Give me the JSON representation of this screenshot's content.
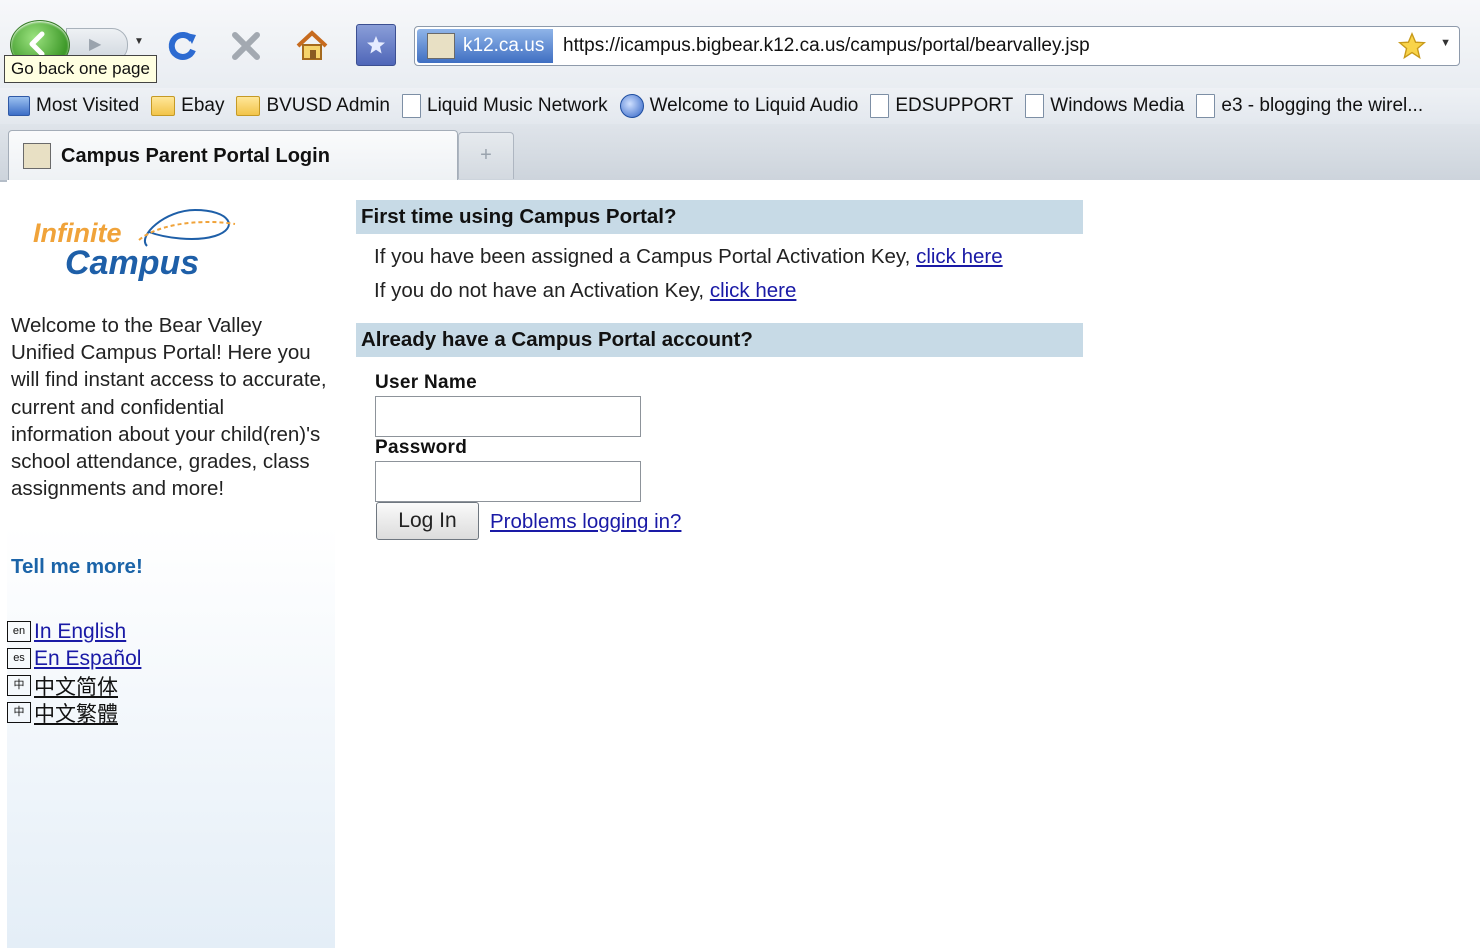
{
  "browser": {
    "tooltip": "Go back one page",
    "identity_label": "k12.ca.us",
    "url": "https://icampus.bigbear.k12.ca.us/campus/portal/bearvalley.jsp",
    "bookmarks": [
      {
        "label": "Most Visited",
        "icon": "most-visited-icon"
      },
      {
        "label": "Ebay",
        "icon": "folder-icon"
      },
      {
        "label": "BVUSD Admin",
        "icon": "folder-icon"
      },
      {
        "label": "Liquid Music Network",
        "icon": "page-icon"
      },
      {
        "label": "Welcome to Liquid Audio",
        "icon": "globe-icon"
      },
      {
        "label": "EDSUPPORT",
        "icon": "page-icon"
      },
      {
        "label": "Windows Media",
        "icon": "page-icon"
      },
      {
        "label": "e3 - blogging the wirel...",
        "icon": "page-icon"
      }
    ],
    "tab_title": "Campus Parent Portal Login",
    "new_tab_symbol": "+"
  },
  "logo": {
    "line1": "Infinite",
    "line2": "Campus"
  },
  "sidebar": {
    "welcome": "Welcome to the Bear Valley Unified Campus Portal! Here you will find instant access to accurate, current and confidential information about your child(ren)'s school attendance, grades, class assignments and more!",
    "tell_more": "Tell me more!",
    "languages": [
      {
        "flag": "en",
        "label": "In English"
      },
      {
        "flag": "es",
        "label": "En Español"
      },
      {
        "flag": "中",
        "label": "中文简体"
      },
      {
        "flag": "中",
        "label": "中文繁體"
      }
    ]
  },
  "main": {
    "first_time_header": "First time using Campus Portal?",
    "activation_have_text": "If you have been assigned a Campus Portal Activation Key, ",
    "activation_have_link": "click here",
    "activation_not_text": "If you do not have an Activation Key, ",
    "activation_not_link": "click here",
    "account_header": "Already have a Campus Portal account?",
    "username_label": "User Name",
    "username_value": "",
    "password_label": "Password",
    "password_value": "",
    "login_button": "Log In",
    "problems_link": "Problems logging in?"
  },
  "colors": {
    "section_header_bg": "#c7dae6",
    "link": "#1a1aa6",
    "tell_more": "#1b64a8",
    "logo_orange": "#f0a33a",
    "logo_blue": "#1e5fa8"
  }
}
